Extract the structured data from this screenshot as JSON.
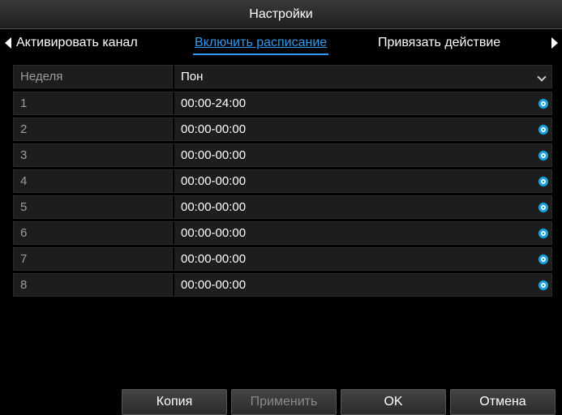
{
  "window": {
    "title": "Настройки"
  },
  "tabs": [
    {
      "label": "Активировать канал",
      "active": false
    },
    {
      "label": "Включить расписание",
      "active": true
    },
    {
      "label": "Привязать действие",
      "active": false
    }
  ],
  "week": {
    "label": "Неделя",
    "value": "Пон"
  },
  "schedule": [
    {
      "index": "1",
      "time": "00:00-24:00"
    },
    {
      "index": "2",
      "time": "00:00-00:00"
    },
    {
      "index": "3",
      "time": "00:00-00:00"
    },
    {
      "index": "4",
      "time": "00:00-00:00"
    },
    {
      "index": "5",
      "time": "00:00-00:00"
    },
    {
      "index": "6",
      "time": "00:00-00:00"
    },
    {
      "index": "7",
      "time": "00:00-00:00"
    },
    {
      "index": "8",
      "time": "00:00-00:00"
    }
  ],
  "buttons": {
    "copy": "Копия",
    "apply": "Применить",
    "ok": "OK",
    "cancel": "Отмена"
  },
  "colors": {
    "accent": "#2f9bf0",
    "icon": "#1aa3e0"
  }
}
